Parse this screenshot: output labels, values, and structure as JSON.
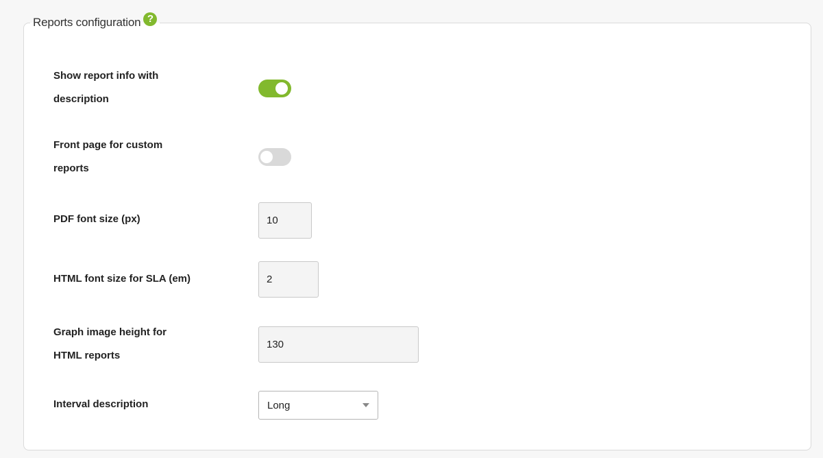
{
  "section": {
    "title": "Reports configuration",
    "help_glyph": "?"
  },
  "fields": {
    "show_report_info": {
      "label_line1": "Show report info with",
      "label_line2": "description",
      "enabled": true
    },
    "front_page": {
      "label_line1": "Front page for custom",
      "label_line2": "reports",
      "enabled": false
    },
    "pdf_font_size": {
      "label": "PDF font size (px)",
      "value": "10"
    },
    "html_font_size_sla": {
      "label": "HTML font size for SLA (em)",
      "value": "2"
    },
    "graph_image_height": {
      "label_line1": "Graph image height for",
      "label_line2": "HTML reports",
      "value": "130"
    },
    "interval_description": {
      "label": "Interval description",
      "selected": "Long"
    }
  },
  "colors": {
    "accent": "#82b92e",
    "toggle_off": "#d9d9d9"
  }
}
